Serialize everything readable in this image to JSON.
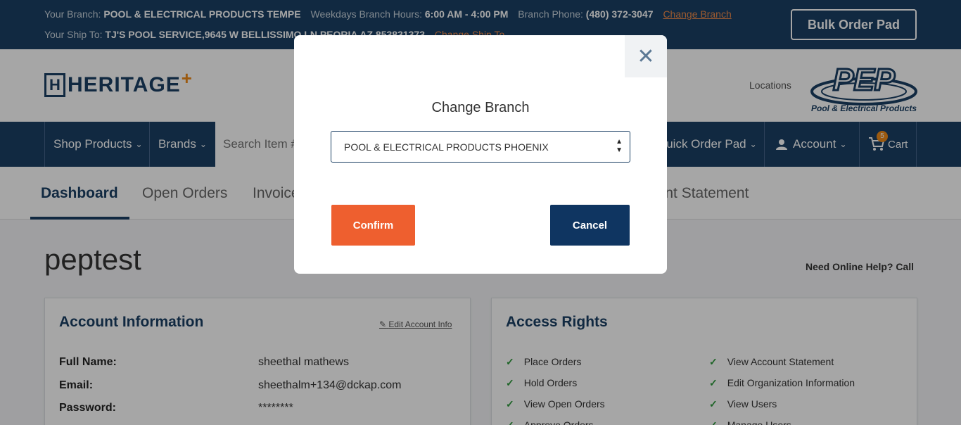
{
  "topbar": {
    "branch_label": "Your Branch:",
    "branch_value": "POOL & ELECTRICAL PRODUCTS TEMPE",
    "hours_label": "Weekdays Branch Hours:",
    "hours_value": "6:00 AM - 4:00 PM",
    "phone_label": "Branch Phone:",
    "phone_value": "(480) 372-3047",
    "change_branch_link": "Change Branch",
    "shipto_label": "Your Ship To:",
    "shipto_value": "TJ'S POOL SERVICE,9645 W BELLISSIMO LN PEORIA AZ 853831373",
    "change_shipto_link": "Change Ship To",
    "bulk_order_button": "Bulk Order Pad"
  },
  "header": {
    "logo_letter": "H",
    "logo_text": "HERITAGE",
    "logo_plus": "+",
    "locations_link": "Locations",
    "pep_letters": "PEP",
    "pep_tagline": "Pool & Electrical Products"
  },
  "nav": {
    "shop_products": "Shop Products",
    "brands": "Brands",
    "search_placeholder": "Search Item #",
    "quick_order_pad": "Quick Order Pad",
    "account": "Account",
    "cart": "Cart",
    "cart_count": "5"
  },
  "tabs": {
    "dashboard": "Dashboard",
    "open_orders": "Open Orders",
    "invoices": "Invoices",
    "account_statement": "Account Statement"
  },
  "main": {
    "username": "peptest",
    "help_text": "Need Online Help? Call"
  },
  "account_info": {
    "title": "Account Information",
    "edit_link": "Edit Account Info",
    "rows": [
      {
        "label": "Full Name:",
        "value": "sheethal mathews"
      },
      {
        "label": "Email:",
        "value": "sheethalm+134@dckap.com"
      },
      {
        "label": "Password:",
        "value": "********"
      }
    ]
  },
  "access_rights": {
    "title": "Access Rights",
    "left": [
      "Place Orders",
      "Hold Orders",
      "View Open Orders",
      "Approve Orders"
    ],
    "right": [
      "View Account Statement",
      "Edit Organization Information",
      "View Users",
      "Manage Users"
    ]
  },
  "modal": {
    "title": "Change Branch",
    "selected_branch": "POOL & ELECTRICAL PRODUCTS PHOENIX",
    "confirm": "Confirm",
    "cancel": "Cancel"
  },
  "colors": {
    "primary": "#1b4064",
    "accent": "#ee5f2f",
    "cancel_button": "#0f3561",
    "check": "#2e9a3c"
  }
}
